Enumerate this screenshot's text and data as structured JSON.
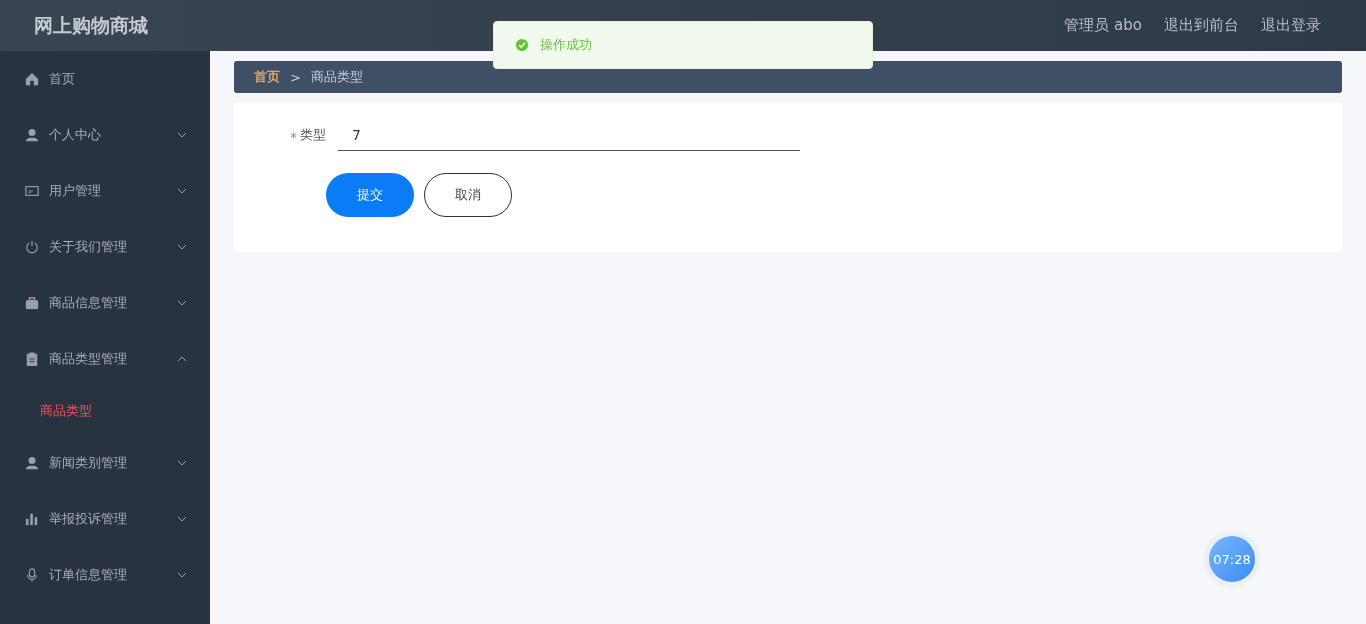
{
  "header": {
    "title": "网上购物商城",
    "links": [
      "管理员 abo",
      "退出到前台",
      "退出登录"
    ]
  },
  "toast": {
    "message": "操作成功"
  },
  "sidebar": {
    "items": [
      {
        "label": "首页",
        "kind": "link"
      },
      {
        "label": "个人中心",
        "kind": "group",
        "expanded": false
      },
      {
        "label": "用户管理",
        "kind": "group",
        "expanded": false
      },
      {
        "label": "关于我们管理",
        "kind": "group",
        "expanded": false
      },
      {
        "label": "商品信息管理",
        "kind": "group",
        "expanded": false
      },
      {
        "label": "商品类型管理",
        "kind": "group",
        "expanded": true,
        "children": [
          {
            "label": "商品类型",
            "selected": true
          }
        ]
      },
      {
        "label": "新闻类别管理",
        "kind": "group",
        "expanded": false
      },
      {
        "label": "举报投诉管理",
        "kind": "group",
        "expanded": false
      },
      {
        "label": "订单信息管理",
        "kind": "group",
        "expanded": false
      }
    ]
  },
  "breadcrumb": [
    "首页",
    "商品类型"
  ],
  "breadcrumb_separator": ">",
  "form": {
    "fields": [
      {
        "label": "类型",
        "required": true,
        "value": "7"
      }
    ],
    "buttons": [
      {
        "label": "提交",
        "kind": "primary"
      },
      {
        "label": "取消",
        "kind": "plain"
      }
    ]
  },
  "clock": {
    "time": "07:28"
  }
}
